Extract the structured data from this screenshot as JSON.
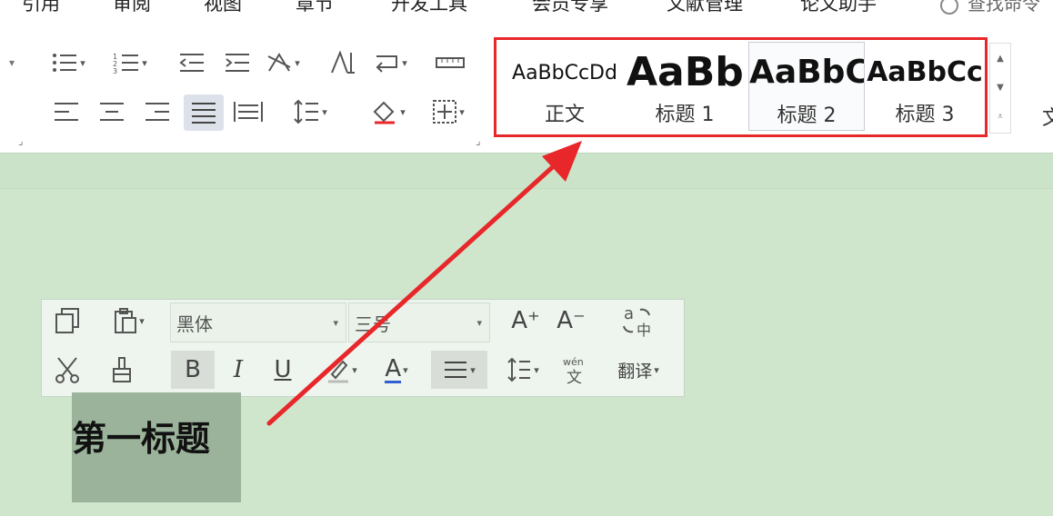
{
  "tabs": [
    "引用",
    "审阅",
    "视图",
    "章节",
    "开发工具",
    "会员专享",
    "文献管理",
    "论文助手"
  ],
  "search": {
    "placeholder": "查找命令"
  },
  "ribbon": {
    "row1": [
      "bullets-icon",
      "numbering-icon",
      "decrease-indent-icon",
      "increase-indent-icon",
      "text-direction-icon",
      "sort-icon",
      "line-break-icon",
      "ruler-icon"
    ],
    "row2": [
      "align-left-icon",
      "align-center-icon",
      "align-right-icon",
      "justify-icon",
      "distribute-icon",
      "line-spacing-icon",
      "shading-icon",
      "borders-icon"
    ]
  },
  "styles": [
    {
      "preview": "AaBbCcDd",
      "name": "正文"
    },
    {
      "preview": "AaBb",
      "name": "标题 1"
    },
    {
      "preview": "AaBbC",
      "name": "标题 2"
    },
    {
      "preview": "AaBbCc",
      "name": "标题 3"
    }
  ],
  "edge_char": "文",
  "mini_toolbar": {
    "font": "黑体",
    "size": "三号",
    "grow_font": "A⁺",
    "shrink_font": "A⁻",
    "bold": "B",
    "italic": "I",
    "underline": "U",
    "font_color": "A",
    "translate": "翻译"
  },
  "document": {
    "heading": "第一标题"
  },
  "colors": {
    "accent": "#e8272b",
    "canvas": "#cfe6cd"
  }
}
